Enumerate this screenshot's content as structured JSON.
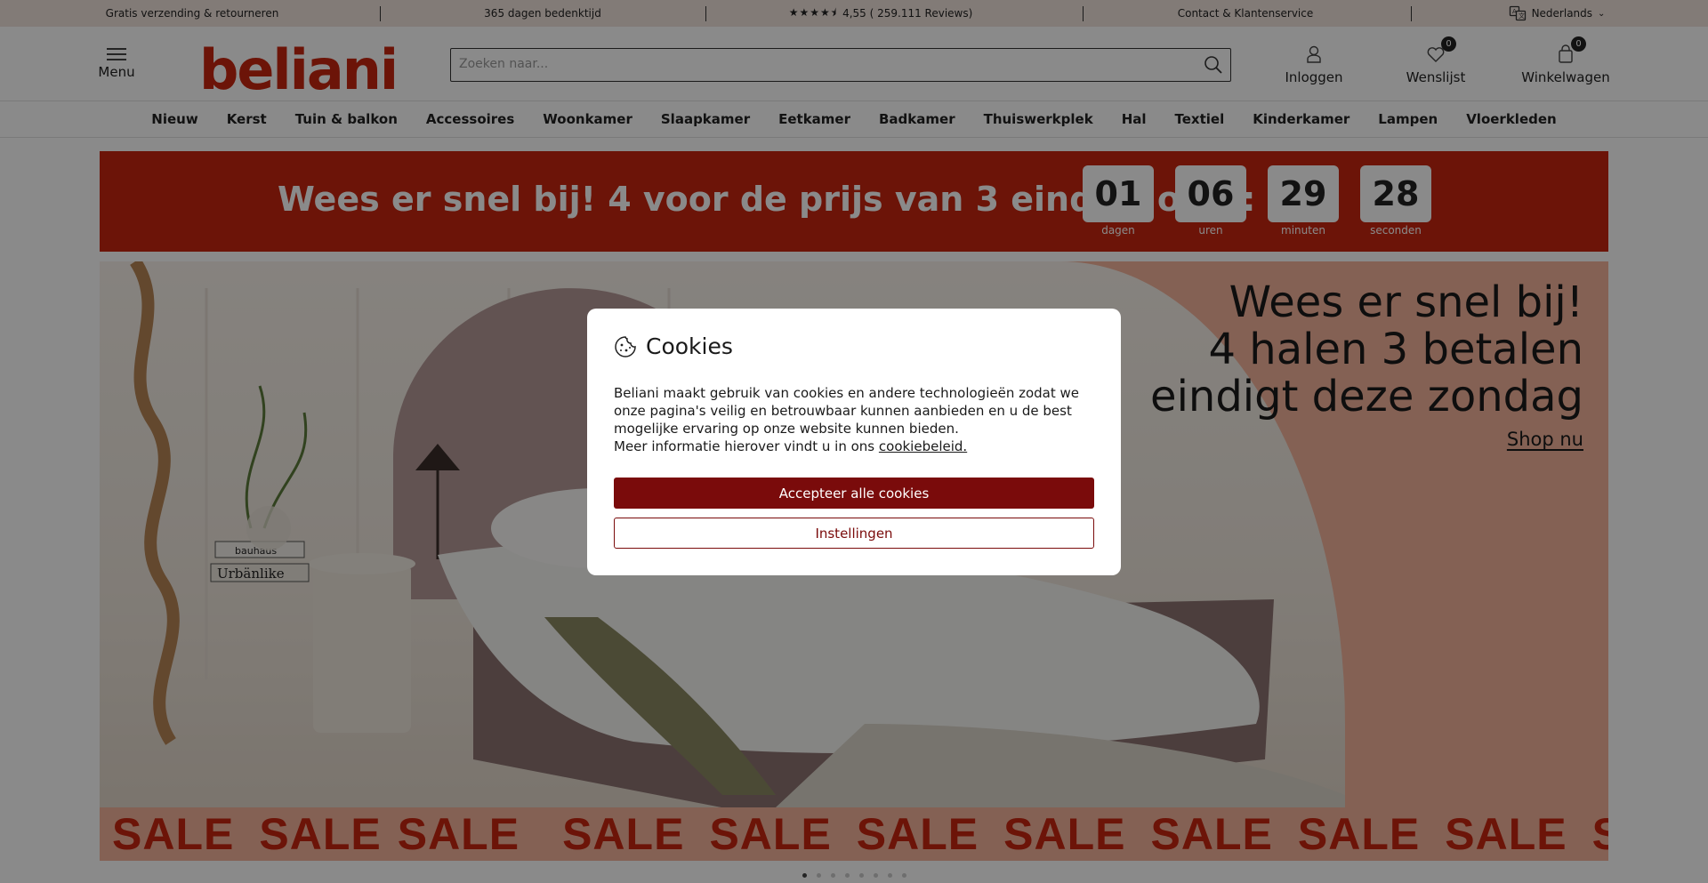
{
  "topbar": {
    "shipping": "Gratis verzending & retourneren",
    "return_period": "365 dagen bedenktijd",
    "rating": "4,55 ( 259.111 Reviews)",
    "contact": "Contact & Klantenservice",
    "language": "Nederlands"
  },
  "header": {
    "menu_label": "Menu",
    "logo_text": "beliani",
    "search_placeholder": "Zoeken naar...",
    "login_label": "Inloggen",
    "wishlist_label": "Wenslijst",
    "wishlist_count": "0",
    "cart_label": "Winkelwagen",
    "cart_count": "0"
  },
  "categories": [
    "Nieuw",
    "Kerst",
    "Tuin & balkon",
    "Accessoires",
    "Woonkamer",
    "Slaapkamer",
    "Eetkamer",
    "Badkamer",
    "Thuiswerkplek",
    "Hal",
    "Textiel",
    "Kinderkamer",
    "Lampen",
    "Vloerkleden"
  ],
  "countdown": {
    "message": "Wees er snel bij! 4 voor de prijs van 3 eindigt over:",
    "units": [
      {
        "value": "01",
        "label": "dagen"
      },
      {
        "value": "06",
        "label": "uren"
      },
      {
        "value": "29",
        "label": "minuten"
      },
      {
        "value": "28",
        "label": "seconden"
      }
    ]
  },
  "hero": {
    "title_lines": [
      "Wees er snel bij!",
      "4 halen 3 betalen",
      "eindigt deze zondag"
    ],
    "cta": "Shop nu",
    "sale_word": "SALE",
    "sale_count": 11,
    "book_labels": [
      "bauhaus",
      "Urbänlike"
    ]
  },
  "carousel": {
    "count": 8,
    "active": 0
  },
  "cookie_modal": {
    "title": "Cookies",
    "body_line1": "Beliani maakt gebruik van cookies en andere technologieën zodat we onze pagina's veilig en betrouwbaar kunnen aanbieden en u de best mogelijke ervaring op onze website kunnen bieden.",
    "body_line2_prefix": "Meer informatie hierover vindt u in ons ",
    "policy_link": "cookiebeleid.",
    "accept_label": "Accepteer alle cookies",
    "settings_label": "Instellingen"
  },
  "colors": {
    "brand_red": "#c8260f",
    "accept_button": "#7a0b0b",
    "topbar_bg": "#f1e4dd"
  }
}
